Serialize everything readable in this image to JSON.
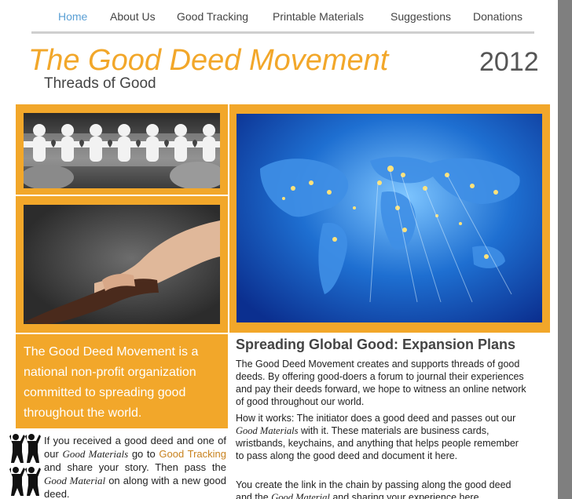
{
  "nav": {
    "items": [
      {
        "label": "Home",
        "active": true
      },
      {
        "label": "About Us"
      },
      {
        "label": "Good Tracking"
      },
      {
        "label": "Printable Materials"
      },
      {
        "label": "Suggestions"
      },
      {
        "label": "Donations"
      }
    ]
  },
  "header": {
    "title": "The Good Deed Movement",
    "subtitle": "Threads of Good",
    "year": "2012"
  },
  "intro": "The Good Deed Movement is a national non-profit organization committed to spreading good throughout the world.",
  "main": {
    "heading": "Spreading Global Good: Expansion Plans",
    "p1": "The Good Deed Movement creates and supports threads of good deeds. By offering good-doers a forum to journal their experiences and pay their deeds forward, we hope to witness an online network of good throughout our world.",
    "p2_a": "How it works: The initiator does a good deed and passes out our ",
    "p2_em": "Good Materials",
    "p2_b": " with it. These materials are business cards, wristbands, keychains, and anything that helps people remember to pass along the good deed and document it here.",
    "p3_a": "You create the link in the chain by passing along the good deed and the ",
    "p3_em": "Good Material",
    "p3_b": " and sharing your experience here"
  },
  "sidebar": {
    "t1": "If you received a good deed and one of our ",
    "em1": "Good Materials",
    "t2": " go to ",
    "link": "Good Tracking",
    "t3": " and share your story. Then pass the ",
    "em2": "Good Material",
    "t4": " on along with a new good deed."
  },
  "colors": {
    "accent": "#f2a72a",
    "nav_active": "#5a9fd4",
    "scrollbar": "#7f7f7f"
  }
}
